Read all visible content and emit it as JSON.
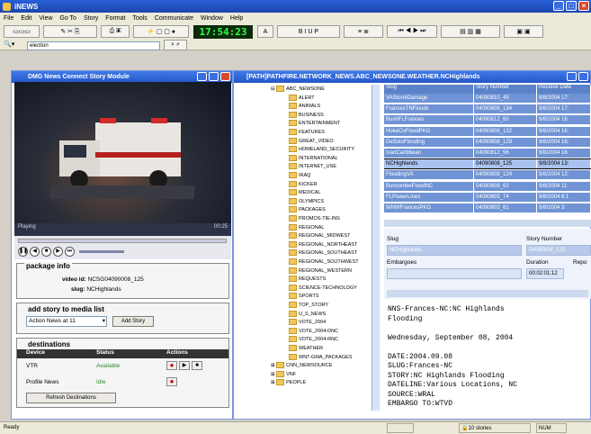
{
  "app": {
    "title": "iNEWS"
  },
  "menu": [
    "File",
    "Edit",
    "View",
    "Go To",
    "Story",
    "Format",
    "Tools",
    "Communicate",
    "Window",
    "Help"
  ],
  "toolbar": {
    "clock": "17:54:23",
    "search_value": "election"
  },
  "video_pane": {
    "title": "DMG News Connect Story Module",
    "status": "Playing",
    "time": "00:25",
    "package_info_heading": "package info",
    "video_id_label": "video id:",
    "video_id": "NCSG04090008_125",
    "slug_label": "slug:",
    "slug": "NCHighlands",
    "add_story_heading": "add story to media list",
    "media_list_value": "Action News at 11",
    "add_story_button": "Add Story",
    "destinations_heading": "destinations",
    "dest_columns": [
      "Device",
      "Status",
      "Actions"
    ],
    "destinations": [
      {
        "device": "VTR",
        "status": "Available"
      },
      {
        "device": "Profile News",
        "status": "Idle"
      }
    ],
    "refresh_button": "Refresh Destinations"
  },
  "tree_pane": {
    "title": "[PATH]PATHFIRE.NETWORK_NEWS.ABC_NEWSONE.WEATHER.NCHighlands",
    "root": "ABC_NEWSONE",
    "folders": [
      "ALERT",
      "ANIMALS",
      "BUSINESS",
      "ENTERTAINMENT",
      "FEATURES",
      "GREAT_VIDEO",
      "HOMELAND_SECURITY",
      "INTERNATIONAL",
      "INTERNET_USE",
      "IRAQ",
      "KICKER",
      "MEDICAL",
      "OLYMPICS",
      "PACKAGES",
      "PROMOS-TIE-INS",
      "REGIONAL",
      "REGIONAL_MIDWEST",
      "REGIONAL_NORTHEAST",
      "REGIONAL_SOUTHEAST",
      "REGIONAL_SOUTHWEST",
      "REGIONAL_WESTERN",
      "REQUESTS",
      "SCIENCE-TECHNOLOGY",
      "SPORTS",
      "TOP_STORY",
      "U_S_NEWS",
      "VOTE_2004",
      "VOTE_2004-DNC",
      "VOTE_2004-RNC",
      "WEATHER",
      "WNT-GMA_PACKAGES"
    ],
    "after": [
      "CNN_NEWSOURCE",
      "VNF",
      "PEOPLE"
    ]
  },
  "grid": {
    "columns": [
      "Slug",
      "Story Number",
      "Receive Date"
    ],
    "rows": [
      [
        "VAStormDamage",
        "04090810_45",
        "9/8/2004 17:"
      ],
      [
        "FrancesTNFloods",
        "04090808_134",
        "9/8/2004 17:"
      ],
      [
        "BushFLFrances",
        "04090812_60",
        "9/8/2004 16:"
      ],
      [
        "HokeCoFloodPKG",
        "04090808_132",
        "9/8/2004 16:"
      ],
      [
        "DeSotoFlooding",
        "04090808_129",
        "9/8/2004 16:"
      ],
      [
        "IvanCaribbean",
        "04090812_56",
        "9/8/2004 16:"
      ],
      [
        "NCHighlands",
        "04090808_125",
        "9/8/2004 13:"
      ],
      [
        "FloodingVA",
        "04090808_124",
        "9/8/2004 12:"
      ],
      [
        "BuncombeFloodNC",
        "04090808_62",
        "9/8/2004 11:"
      ],
      [
        "FLPowerLines",
        "04090803_74",
        "9/8/2004 6:1"
      ],
      [
        "WNWFrancesPKG",
        "04090803_61",
        "9/8/2004 3:"
      ]
    ]
  },
  "detail": {
    "slug_label": "Slug",
    "slug_value": "NCHighlands",
    "story_number_label": "Story Number",
    "story_number_value": "04090808_125",
    "embargoes_label": "Embargoes",
    "duration_label": "Duration",
    "duration_value": "00:02:01:12",
    "report_label": "Repo"
  },
  "script_text": "NNS-Frances-NC:NC Highlands\nFlooding\n\nWednesday, September 08, 2004\n\nDATE:2004.09.08\nSLUG:Frances-NC\nSTORY:NC Highlands Flooding\nDATELINE:Various Locations, NC\nSOURCE:WRAL\nEMBARGO TO:WTVD",
  "statusbar": {
    "ready": "Ready",
    "stories": "10 stories",
    "num": "NUM"
  },
  "colors": {
    "accent": "#2456c8",
    "selected_row": "#a9c2ef",
    "row": "#6f93d4"
  }
}
